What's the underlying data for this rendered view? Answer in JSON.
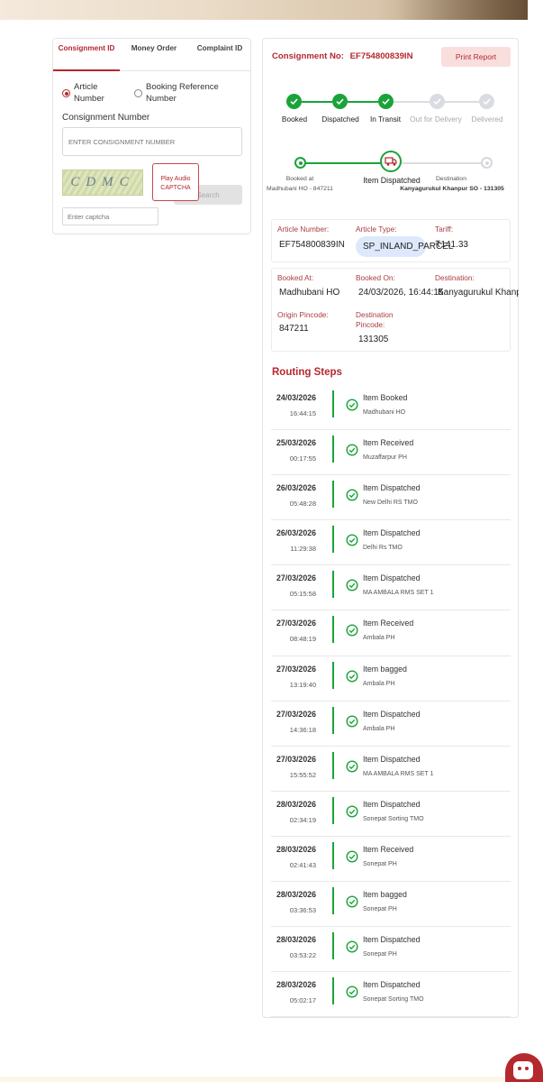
{
  "search_form": {
    "tabs": [
      {
        "label": "Consignment ID",
        "active": true
      },
      {
        "label": "Money Order",
        "active": false
      },
      {
        "label": "Complaint ID",
        "active": false
      }
    ],
    "search_type_options": [
      {
        "label": "Article Number",
        "selected": true
      },
      {
        "label": "Booking Reference Number",
        "selected": false
      }
    ],
    "consignment_label": "Consignment Number",
    "consignment_placeholder": "ENTER CONSIGNMENT NUMBER",
    "captcha_text": "CDMC",
    "audio_captcha_label": "Play Audio CAPTCHA",
    "search_label": "Search",
    "captcha_placeholder": "Enter captcha"
  },
  "tracking": {
    "title_prefix": "Consignment No:",
    "consignment_no": "EF754800839IN",
    "print_label": "Print Report",
    "progress_steps": [
      {
        "label": "Booked",
        "done": true
      },
      {
        "label": "Dispatched",
        "done": true
      },
      {
        "label": "In Transit",
        "done": true
      },
      {
        "label": "Out for Delivery",
        "done": false
      },
      {
        "label": "Delivered",
        "done": false
      }
    ],
    "journey": {
      "origin_caption": "Booked at",
      "origin_office": "Madhubani HO - 847211",
      "current_status": "Item Dispatched",
      "destination_caption": "Destination",
      "destination_office": "Kanyagurukul Khanpur SO - 131305"
    },
    "details": {
      "article_number_label": "Article Number:",
      "article_number": "EF754800839IN",
      "article_type_label": "Article Type:",
      "article_type": "SP_INLAND_PARCEL",
      "tariff_label": "Tariff:",
      "tariff": "141.33",
      "booked_at_label": "Booked At:",
      "booked_at": "Madhubani HO",
      "booked_on_label": "Booked On:",
      "booked_on": "24/03/2026, 16:44:15",
      "destination_label": "Destination:",
      "destination": "Kanyagurukul Khanpur SO",
      "origin_pincode_label": "Origin Pincode:",
      "origin_pincode": "847211",
      "destination_pincode_label": "Destination Pincode:",
      "destination_pincode": "131305"
    },
    "routing_title": "Routing Steps",
    "routing_steps": [
      {
        "date": "24/03/2026",
        "time": "16:44:15",
        "event": "Item Booked",
        "office": "Madhubani HO"
      },
      {
        "date": "25/03/2026",
        "time": "00:17:55",
        "event": "Item Received",
        "office": "Muzaffarpur PH"
      },
      {
        "date": "26/03/2026",
        "time": "05:48:28",
        "event": "Item Dispatched",
        "office": "New Delhi RS TMO"
      },
      {
        "date": "26/03/2026",
        "time": "11:29:38",
        "event": "Item Dispatched",
        "office": "Delhi Rs TMO"
      },
      {
        "date": "27/03/2026",
        "time": "05:15:58",
        "event": "Item Dispatched",
        "office": "MA AMBALA RMS SET 1"
      },
      {
        "date": "27/03/2026",
        "time": "08:48:19",
        "event": "Item Received",
        "office": "Ambala PH"
      },
      {
        "date": "27/03/2026",
        "time": "13:19:40",
        "event": "Item bagged",
        "office": "Ambala PH"
      },
      {
        "date": "27/03/2026",
        "time": "14:36:18",
        "event": "Item Dispatched",
        "office": "Ambala PH"
      },
      {
        "date": "27/03/2026",
        "time": "15:55:52",
        "event": "Item Dispatched",
        "office": "MA AMBALA RMS SET 1"
      },
      {
        "date": "28/03/2026",
        "time": "02:34:19",
        "event": "Item Dispatched",
        "office": "Sonepat Sorting TMO"
      },
      {
        "date": "28/03/2026",
        "time": "02:41:43",
        "event": "Item Received",
        "office": "Sonepat PH"
      },
      {
        "date": "28/03/2026",
        "time": "03:36:53",
        "event": "Item bagged",
        "office": "Sonepat PH"
      },
      {
        "date": "28/03/2026",
        "time": "03:53:22",
        "event": "Item Dispatched",
        "office": "Sonepat PH"
      },
      {
        "date": "28/03/2026",
        "time": "05:02:17",
        "event": "Item Dispatched",
        "office": "Sonepat Sorting TMO"
      }
    ]
  },
  "colors": {
    "brand_red": "#b5282e",
    "success_green": "#1aa33a",
    "pending_grey": "#d9dde3"
  },
  "icons": {
    "step_done": "check-icon",
    "current_location": "truck-icon",
    "route_event": "check-circle-icon",
    "chatbot": "chatbot-icon"
  }
}
